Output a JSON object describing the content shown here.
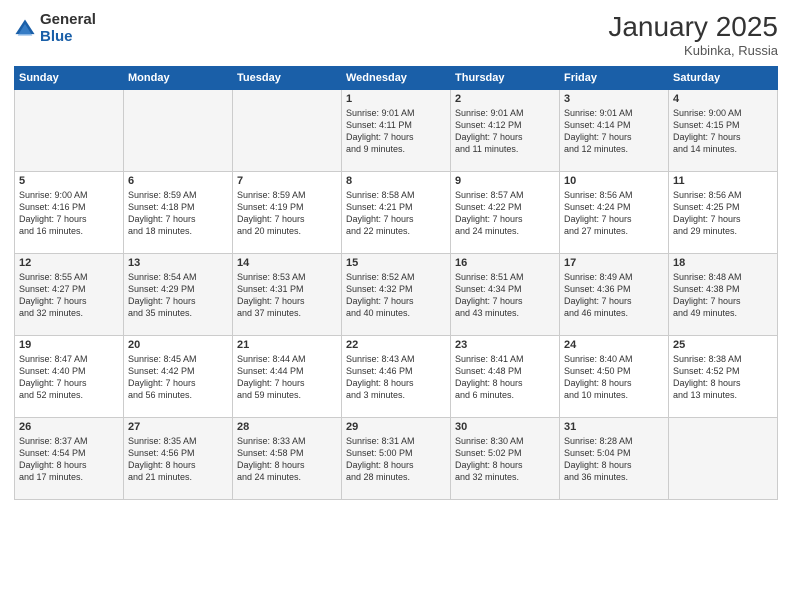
{
  "header": {
    "logo_general": "General",
    "logo_blue": "Blue",
    "month_title": "January 2025",
    "location": "Kubinka, Russia"
  },
  "days_of_week": [
    "Sunday",
    "Monday",
    "Tuesday",
    "Wednesday",
    "Thursday",
    "Friday",
    "Saturday"
  ],
  "weeks": [
    [
      {
        "day": "",
        "info": ""
      },
      {
        "day": "",
        "info": ""
      },
      {
        "day": "",
        "info": ""
      },
      {
        "day": "1",
        "info": "Sunrise: 9:01 AM\nSunset: 4:11 PM\nDaylight: 7 hours\nand 9 minutes."
      },
      {
        "day": "2",
        "info": "Sunrise: 9:01 AM\nSunset: 4:12 PM\nDaylight: 7 hours\nand 11 minutes."
      },
      {
        "day": "3",
        "info": "Sunrise: 9:01 AM\nSunset: 4:14 PM\nDaylight: 7 hours\nand 12 minutes."
      },
      {
        "day": "4",
        "info": "Sunrise: 9:00 AM\nSunset: 4:15 PM\nDaylight: 7 hours\nand 14 minutes."
      }
    ],
    [
      {
        "day": "5",
        "info": "Sunrise: 9:00 AM\nSunset: 4:16 PM\nDaylight: 7 hours\nand 16 minutes."
      },
      {
        "day": "6",
        "info": "Sunrise: 8:59 AM\nSunset: 4:18 PM\nDaylight: 7 hours\nand 18 minutes."
      },
      {
        "day": "7",
        "info": "Sunrise: 8:59 AM\nSunset: 4:19 PM\nDaylight: 7 hours\nand 20 minutes."
      },
      {
        "day": "8",
        "info": "Sunrise: 8:58 AM\nSunset: 4:21 PM\nDaylight: 7 hours\nand 22 minutes."
      },
      {
        "day": "9",
        "info": "Sunrise: 8:57 AM\nSunset: 4:22 PM\nDaylight: 7 hours\nand 24 minutes."
      },
      {
        "day": "10",
        "info": "Sunrise: 8:56 AM\nSunset: 4:24 PM\nDaylight: 7 hours\nand 27 minutes."
      },
      {
        "day": "11",
        "info": "Sunrise: 8:56 AM\nSunset: 4:25 PM\nDaylight: 7 hours\nand 29 minutes."
      }
    ],
    [
      {
        "day": "12",
        "info": "Sunrise: 8:55 AM\nSunset: 4:27 PM\nDaylight: 7 hours\nand 32 minutes."
      },
      {
        "day": "13",
        "info": "Sunrise: 8:54 AM\nSunset: 4:29 PM\nDaylight: 7 hours\nand 35 minutes."
      },
      {
        "day": "14",
        "info": "Sunrise: 8:53 AM\nSunset: 4:31 PM\nDaylight: 7 hours\nand 37 minutes."
      },
      {
        "day": "15",
        "info": "Sunrise: 8:52 AM\nSunset: 4:32 PM\nDaylight: 7 hours\nand 40 minutes."
      },
      {
        "day": "16",
        "info": "Sunrise: 8:51 AM\nSunset: 4:34 PM\nDaylight: 7 hours\nand 43 minutes."
      },
      {
        "day": "17",
        "info": "Sunrise: 8:49 AM\nSunset: 4:36 PM\nDaylight: 7 hours\nand 46 minutes."
      },
      {
        "day": "18",
        "info": "Sunrise: 8:48 AM\nSunset: 4:38 PM\nDaylight: 7 hours\nand 49 minutes."
      }
    ],
    [
      {
        "day": "19",
        "info": "Sunrise: 8:47 AM\nSunset: 4:40 PM\nDaylight: 7 hours\nand 52 minutes."
      },
      {
        "day": "20",
        "info": "Sunrise: 8:45 AM\nSunset: 4:42 PM\nDaylight: 7 hours\nand 56 minutes."
      },
      {
        "day": "21",
        "info": "Sunrise: 8:44 AM\nSunset: 4:44 PM\nDaylight: 7 hours\nand 59 minutes."
      },
      {
        "day": "22",
        "info": "Sunrise: 8:43 AM\nSunset: 4:46 PM\nDaylight: 8 hours\nand 3 minutes."
      },
      {
        "day": "23",
        "info": "Sunrise: 8:41 AM\nSunset: 4:48 PM\nDaylight: 8 hours\nand 6 minutes."
      },
      {
        "day": "24",
        "info": "Sunrise: 8:40 AM\nSunset: 4:50 PM\nDaylight: 8 hours\nand 10 minutes."
      },
      {
        "day": "25",
        "info": "Sunrise: 8:38 AM\nSunset: 4:52 PM\nDaylight: 8 hours\nand 13 minutes."
      }
    ],
    [
      {
        "day": "26",
        "info": "Sunrise: 8:37 AM\nSunset: 4:54 PM\nDaylight: 8 hours\nand 17 minutes."
      },
      {
        "day": "27",
        "info": "Sunrise: 8:35 AM\nSunset: 4:56 PM\nDaylight: 8 hours\nand 21 minutes."
      },
      {
        "day": "28",
        "info": "Sunrise: 8:33 AM\nSunset: 4:58 PM\nDaylight: 8 hours\nand 24 minutes."
      },
      {
        "day": "29",
        "info": "Sunrise: 8:31 AM\nSunset: 5:00 PM\nDaylight: 8 hours\nand 28 minutes."
      },
      {
        "day": "30",
        "info": "Sunrise: 8:30 AM\nSunset: 5:02 PM\nDaylight: 8 hours\nand 32 minutes."
      },
      {
        "day": "31",
        "info": "Sunrise: 8:28 AM\nSunset: 5:04 PM\nDaylight: 8 hours\nand 36 minutes."
      },
      {
        "day": "",
        "info": ""
      }
    ]
  ]
}
